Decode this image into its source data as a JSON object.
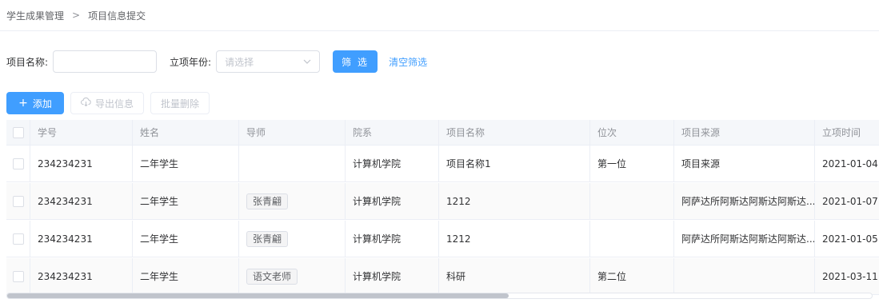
{
  "breadcrumb": {
    "parent": "学生成果管理",
    "separator": ">",
    "current": "项目信息提交"
  },
  "filter": {
    "name_label": "项目名称:",
    "name_value": "",
    "year_label": "立项年份:",
    "year_placeholder": "请选择",
    "filter_button": "筛 选",
    "clear_link": "清空筛选"
  },
  "toolbar": {
    "add_label": "添加",
    "export_label": "导出信息",
    "batch_delete_label": "批量删除"
  },
  "table": {
    "columns": [
      "学号",
      "姓名",
      "导师",
      "院系",
      "项目名称",
      "位次",
      "项目来源",
      "立项时间"
    ],
    "rows": [
      {
        "id": "234234231",
        "name": "二年学生",
        "tutor": "",
        "dept": "计算机学院",
        "project": "项目名称1",
        "rank": "第一位",
        "source": "项目来源",
        "date": "2021-01-04"
      },
      {
        "id": "234234231",
        "name": "二年学生",
        "tutor": "张青翩",
        "dept": "计算机学院",
        "project": "1212",
        "rank": "",
        "source": "阿萨达所阿斯达阿斯达阿斯达...",
        "date": "2021-01-07"
      },
      {
        "id": "234234231",
        "name": "二年学生",
        "tutor": "张青翩",
        "dept": "计算机学院",
        "project": "1212",
        "rank": "",
        "source": "阿萨达所阿斯达阿斯达阿斯达...",
        "date": "2021-01-05"
      },
      {
        "id": "234234231",
        "name": "二年学生",
        "tutor": "语文老师",
        "dept": "计算机学院",
        "project": "科研",
        "rank": "第二位",
        "source": "",
        "date": "2021-03-11"
      }
    ]
  },
  "scroll": {
    "horizontal_fraction": 0.58
  },
  "colors": {
    "primary": "#409eff",
    "border": "#ebeef5",
    "header_bg": "#f5f7fa"
  }
}
